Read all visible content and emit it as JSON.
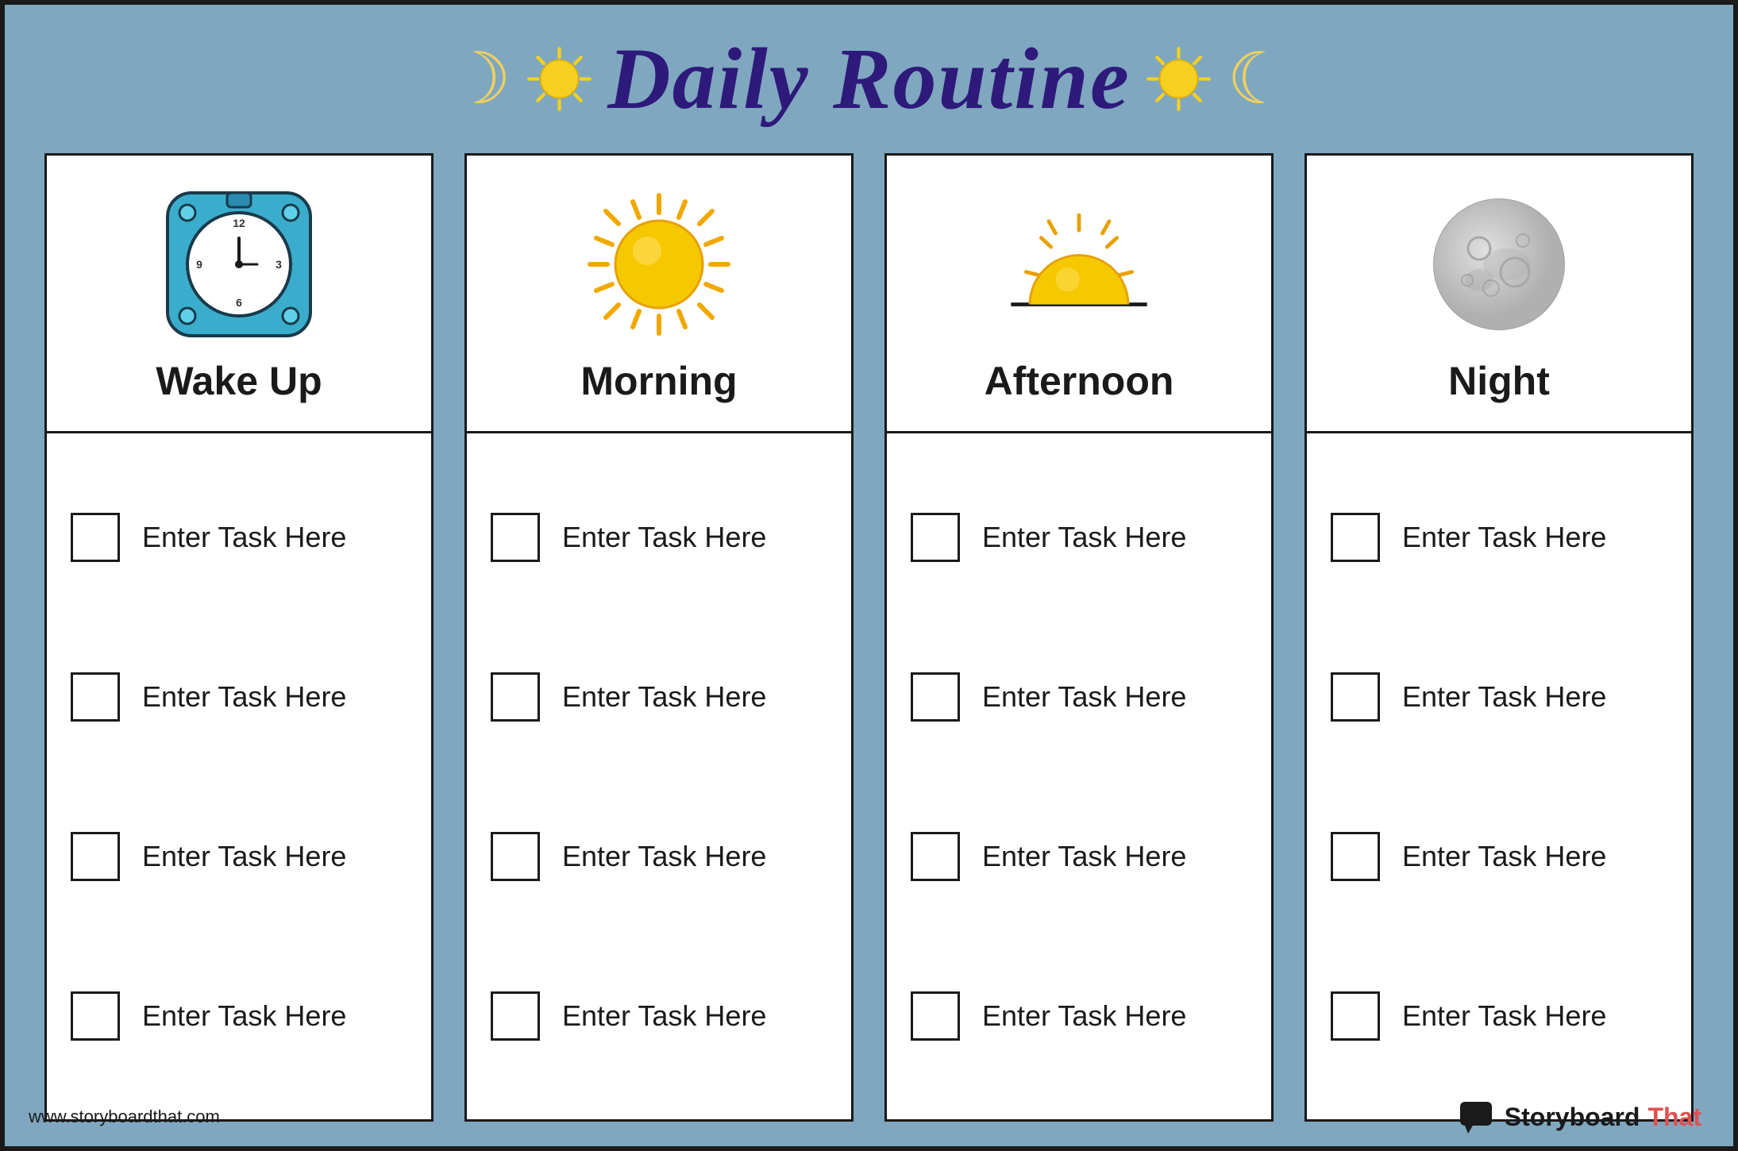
{
  "header": {
    "title": "Daily Routine",
    "moon_symbol": "☽",
    "sun_symbol": "✦"
  },
  "cards": [
    {
      "id": "wake-up",
      "title": "Wake Up",
      "icon_type": "clock",
      "tasks": [
        "Enter Task Here",
        "Enter Task Here",
        "Enter Task Here",
        "Enter Task Here"
      ]
    },
    {
      "id": "morning",
      "title": "Morning",
      "icon_type": "sun",
      "tasks": [
        "Enter Task Here",
        "Enter Task Here",
        "Enter Task Here",
        "Enter Task Here"
      ]
    },
    {
      "id": "afternoon",
      "title": "Afternoon",
      "icon_type": "afternoon-sun",
      "tasks": [
        "Enter Task Here",
        "Enter Task Here",
        "Enter Task Here",
        "Enter Task Here"
      ]
    },
    {
      "id": "night",
      "title": "Night",
      "icon_type": "moon",
      "tasks": [
        "Enter Task Here",
        "Enter Task Here",
        "Enter Task Here",
        "Enter Task Here"
      ]
    }
  ],
  "footer": {
    "url": "www.storyboardthat.com",
    "brand": "Storyboard",
    "brand_highlight": "That"
  }
}
